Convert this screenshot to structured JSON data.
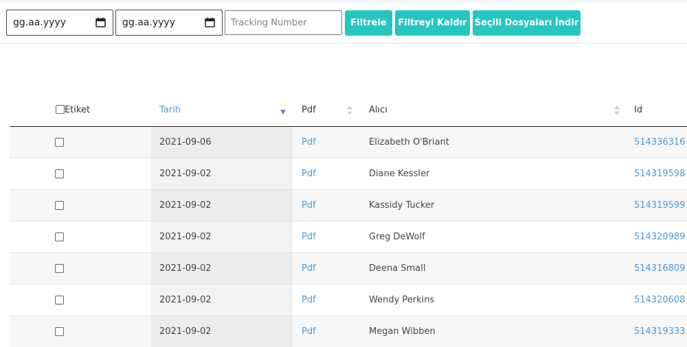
{
  "toolbar": {
    "start_date_placeholder": "gg.aa.yyyy",
    "end_date_placeholder": "gg.aa.yyyy",
    "tracking_placeholder": "Tracking Number",
    "filter_label": "Filtrele",
    "clear_filter_label": "Filtreyi Kaldır",
    "download_selected_label": "Seçili Dosyaları İndir",
    "button_color": "#26c6c0"
  },
  "table": {
    "headers": {
      "label": "Etiket",
      "date": "Tarih",
      "pdf": "Pdf",
      "recipient": "Alıcı",
      "id": "Id"
    },
    "rows": [
      {
        "date": "2021-09-06",
        "pdf": "Pdf",
        "recipient": "Elizabeth O'Briant",
        "id": "514336316"
      },
      {
        "date": "2021-09-02",
        "pdf": "Pdf",
        "recipient": "Diane Kessler",
        "id": "514319598"
      },
      {
        "date": "2021-09-02",
        "pdf": "Pdf",
        "recipient": "Kassidy Tucker",
        "id": "514319599"
      },
      {
        "date": "2021-09-02",
        "pdf": "Pdf",
        "recipient": "Greg DeWolf",
        "id": "514320989"
      },
      {
        "date": "2021-09-02",
        "pdf": "Pdf",
        "recipient": "Deena Small",
        "id": "514316809"
      },
      {
        "date": "2021-09-02",
        "pdf": "Pdf",
        "recipient": "Wendy Perkins",
        "id": "514320608"
      },
      {
        "date": "2021-09-02",
        "pdf": "Pdf",
        "recipient": "Megan Wibben",
        "id": "514319333"
      }
    ],
    "sorted_column": "date",
    "link_color": "#4a9ad8"
  }
}
